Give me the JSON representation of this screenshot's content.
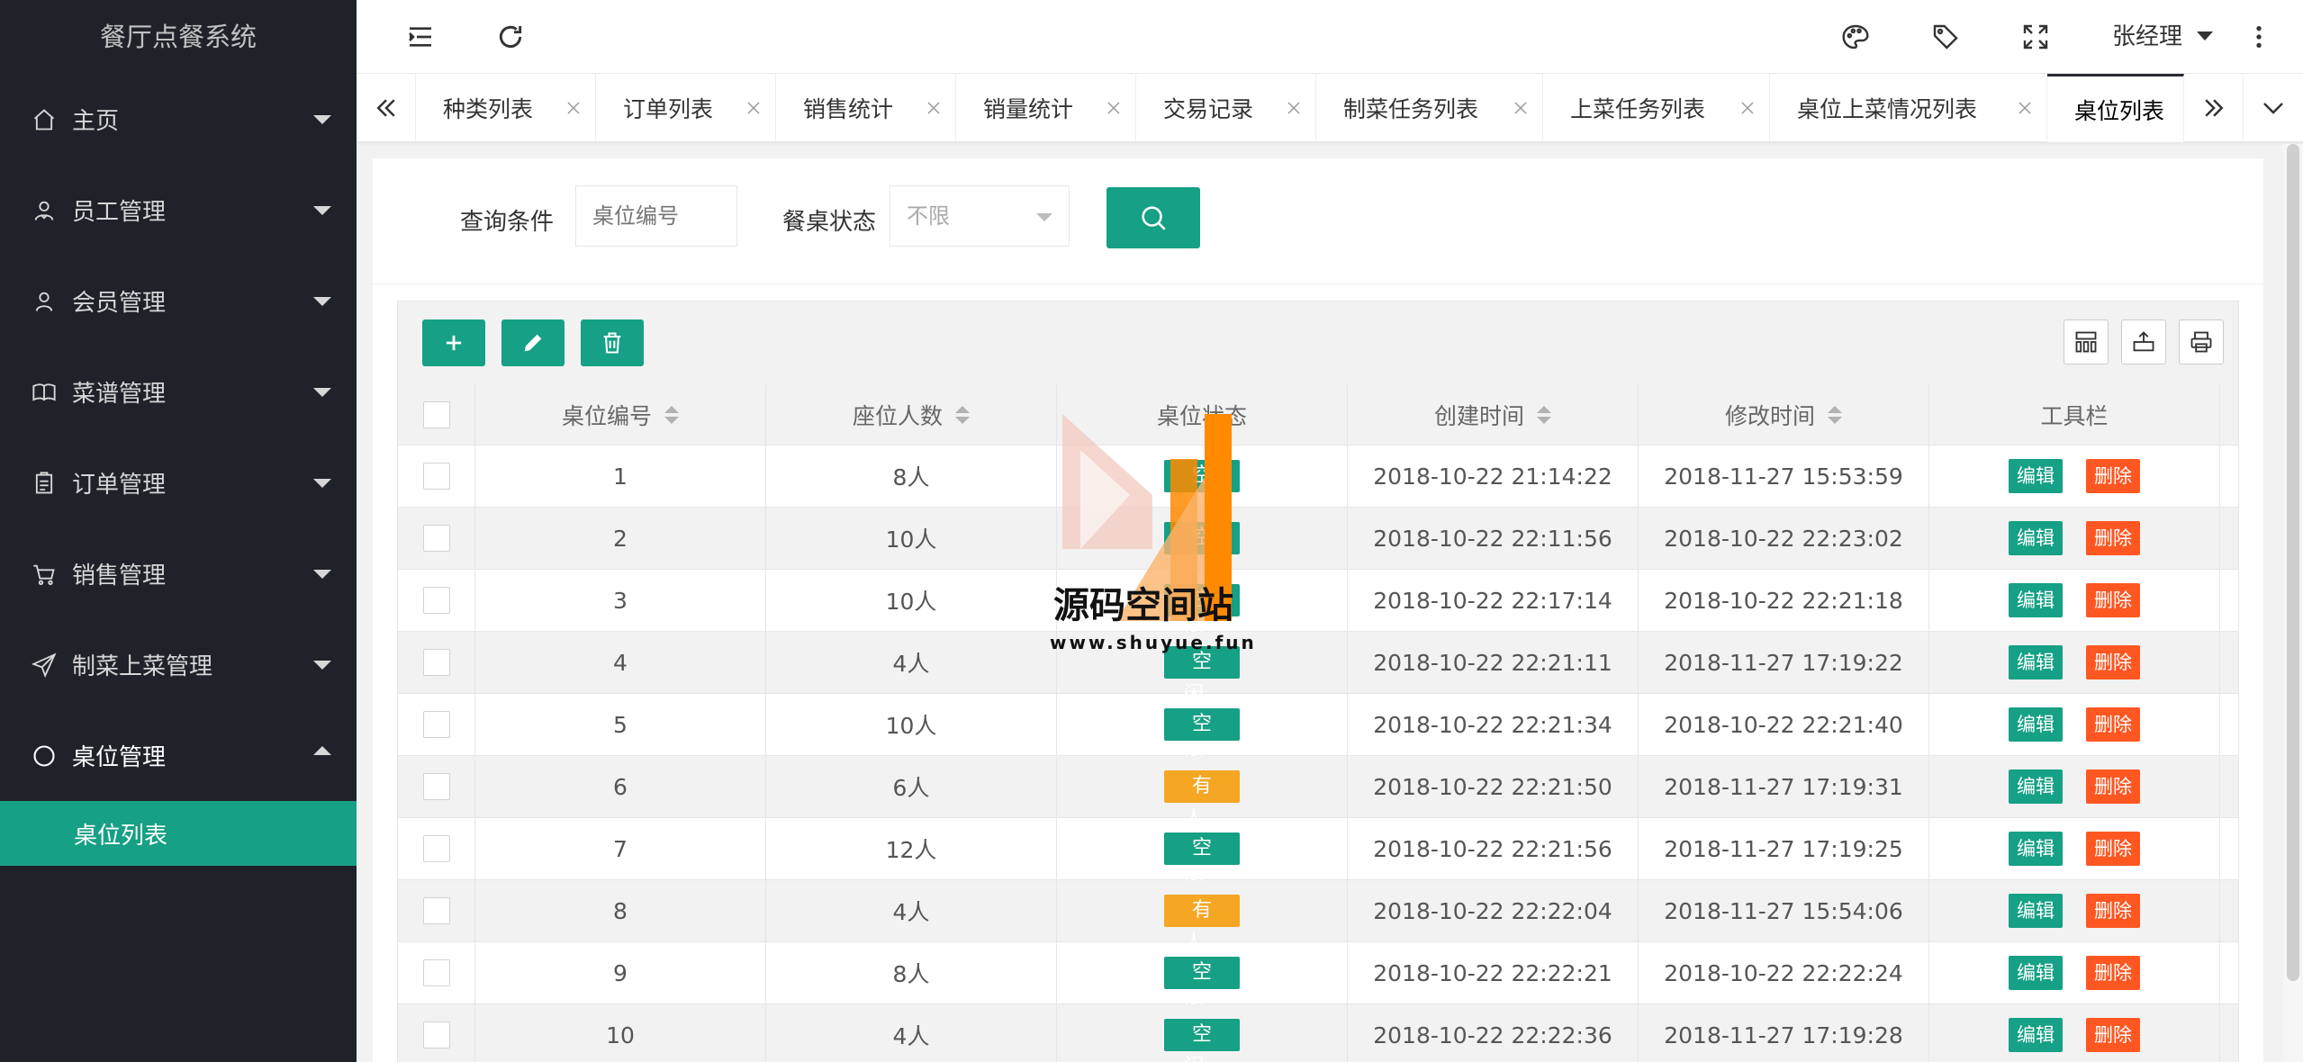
{
  "app": {
    "title": "餐厅点餐系统"
  },
  "sidebar": {
    "items": [
      {
        "label": "主页",
        "icon": "home-icon"
      },
      {
        "label": "员工管理",
        "icon": "staff-icon"
      },
      {
        "label": "会员管理",
        "icon": "user-icon"
      },
      {
        "label": "菜谱管理",
        "icon": "book-icon"
      },
      {
        "label": "订单管理",
        "icon": "clipboard-icon"
      },
      {
        "label": "销售管理",
        "icon": "cart-icon"
      },
      {
        "label": "制菜上菜管理",
        "icon": "send-icon"
      },
      {
        "label": "桌位管理",
        "icon": "circle-icon",
        "open": true
      }
    ],
    "sub_item": "桌位列表"
  },
  "header": {
    "user": "张经理"
  },
  "tabs": [
    {
      "label": "种类列表"
    },
    {
      "label": "订单列表"
    },
    {
      "label": "销售统计"
    },
    {
      "label": "销量统计"
    },
    {
      "label": "交易记录"
    },
    {
      "label": "制菜任务列表"
    },
    {
      "label": "上菜任务列表"
    },
    {
      "label": "桌位上菜情况列表"
    },
    {
      "label": "桌位列表",
      "active": true
    }
  ],
  "search": {
    "label_query": "查询条件",
    "table_no_placeholder": "桌位编号",
    "label_status": "餐桌状态",
    "status_selected": "不限"
  },
  "table": {
    "columns": [
      "桌位编号",
      "座位人数",
      "桌位状态",
      "创建时间",
      "修改时间",
      "工具栏"
    ],
    "edit_label": "编辑",
    "delete_label": "删除",
    "rows": [
      {
        "no": "1",
        "seats": "8人",
        "status": "空闲",
        "status_type": "free",
        "created": "2018-10-22 21:14:22",
        "modified": "2018-11-27 15:53:59"
      },
      {
        "no": "2",
        "seats": "10人",
        "status": "空闲",
        "status_type": "free",
        "created": "2018-10-22 22:11:56",
        "modified": "2018-10-22 22:23:02"
      },
      {
        "no": "3",
        "seats": "10人",
        "status": "空闲",
        "status_type": "free",
        "created": "2018-10-22 22:17:14",
        "modified": "2018-10-22 22:21:18"
      },
      {
        "no": "4",
        "seats": "4人",
        "status": "空闲",
        "status_type": "free",
        "created": "2018-10-22 22:21:11",
        "modified": "2018-11-27 17:19:22"
      },
      {
        "no": "5",
        "seats": "10人",
        "status": "空闲",
        "status_type": "free",
        "created": "2018-10-22 22:21:34",
        "modified": "2018-10-22 22:21:40"
      },
      {
        "no": "6",
        "seats": "6人",
        "status": "有人",
        "status_type": "busy",
        "created": "2018-10-22 22:21:50",
        "modified": "2018-11-27 17:19:31"
      },
      {
        "no": "7",
        "seats": "12人",
        "status": "空闲",
        "status_type": "free",
        "created": "2018-10-22 22:21:56",
        "modified": "2018-11-27 17:19:25"
      },
      {
        "no": "8",
        "seats": "4人",
        "status": "有人",
        "status_type": "busy",
        "created": "2018-10-22 22:22:04",
        "modified": "2018-11-27 15:54:06"
      },
      {
        "no": "9",
        "seats": "8人",
        "status": "空闲",
        "status_type": "free",
        "created": "2018-10-22 22:22:21",
        "modified": "2018-10-22 22:22:24"
      },
      {
        "no": "10",
        "seats": "4人",
        "status": "空闲",
        "status_type": "free",
        "created": "2018-10-22 22:22:36",
        "modified": "2018-11-27 17:19:28"
      }
    ]
  },
  "watermark": {
    "title": "源码空间站",
    "url": "www.shuyue.fun"
  },
  "colors": {
    "sidebar_bg": "#20222a",
    "accent": "#16a085",
    "busy": "#f5a623",
    "danger": "#ff5722"
  }
}
